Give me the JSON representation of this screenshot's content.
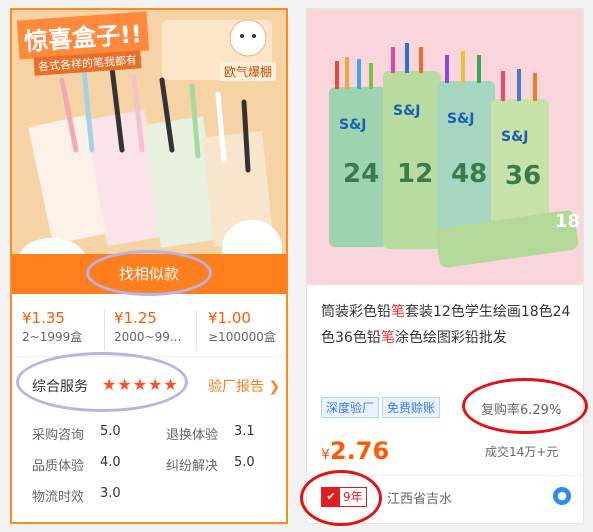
{
  "left_card": {
    "image_banner": "惊喜盒子!!",
    "image_subtitle": "各式各样的笔我都有",
    "image_sticker": "欧气爆棚",
    "find_similar": "找相似款",
    "price_tiers": [
      {
        "price": "¥1.35",
        "qty": "2~1999盒"
      },
      {
        "price": "¥1.25",
        "qty": "2000~99..."
      },
      {
        "price": "¥1.00",
        "qty": "≥100000盒"
      }
    ],
    "service_label": "综合服务",
    "stars": "★★★★★",
    "factory_report": "验厂报告 ❯",
    "metrics": [
      {
        "label": "采购咨询",
        "value": "5.0"
      },
      {
        "label": "退换体验",
        "value": "3.1"
      },
      {
        "label": "品质体验",
        "value": "4.0"
      },
      {
        "label": "纠纷解决",
        "value": "5.0"
      },
      {
        "label": "物流时效",
        "value": "3.0"
      }
    ]
  },
  "right_card": {
    "brand_on_tube": "S&J",
    "tube_numbers": [
      "24",
      "12",
      "48",
      "36",
      "18"
    ],
    "title_part1": "筒装彩色铅",
    "title_red1": "笔",
    "title_part2": "套装12色学生绘画18色24色36色铅",
    "title_red2": "笔",
    "title_part3": "涂色绘图彩铅批发",
    "tags": [
      "深度验厂",
      "免费赊账"
    ],
    "repeat_rate": "复购率6.29%",
    "price_symbol": "¥",
    "price": "2.76",
    "deals": "成交14万+元",
    "years": "9年",
    "location": "江西省吉水"
  },
  "colors": {
    "accent": "#ff7e1e",
    "price": "#ff5a00",
    "annotation_red": "#e31212",
    "annotation_lavender": "#b7b3e8",
    "tag_blue": "#3a7ad6"
  }
}
